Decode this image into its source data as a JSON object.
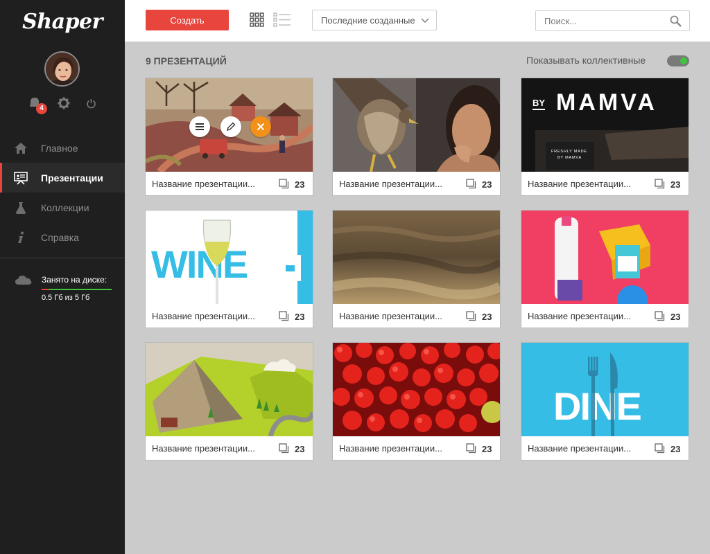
{
  "app": {
    "logo": "Shaper"
  },
  "user": {
    "notifications": "4"
  },
  "sidebar": {
    "items": [
      {
        "label": "Главное",
        "icon": "home-icon",
        "active": false
      },
      {
        "label": "Презентации",
        "icon": "presentation-icon",
        "active": true
      },
      {
        "label": "Коллекции",
        "icon": "flask-icon",
        "active": false
      },
      {
        "label": "Справка",
        "icon": "info-icon",
        "active": false
      }
    ],
    "disk": {
      "label": "Занято на диске:",
      "value": "0.5 Гб из 5 Гб",
      "used_fraction": 0.1,
      "icon": "cloud-icon"
    }
  },
  "toolbar": {
    "create_label": "Создать",
    "sort_value": "Последние созданные",
    "search_placeholder": "Поиск..."
  },
  "content": {
    "count_label": "9 ПРЕЗЕНТАЦИЙ",
    "shared_label": "Показывать коллективные",
    "shared_on": true,
    "cards": [
      {
        "title": "Название презентации...",
        "slides": "23"
      },
      {
        "title": "Название презентации...",
        "slides": "23"
      },
      {
        "title": "Название презентации...",
        "slides": "23",
        "brand_prefix": "BY",
        "brand": "MAMVA",
        "brand_sub1": "FRESHLY MADE",
        "brand_sub2": "BY MAMVA"
      },
      {
        "title": "Название презентации...",
        "slides": "23",
        "word": "WINE"
      },
      {
        "title": "Название презентации...",
        "slides": "23"
      },
      {
        "title": "Название презентации...",
        "slides": "23"
      },
      {
        "title": "Название презентации...",
        "slides": "23"
      },
      {
        "title": "Название презентации...",
        "slides": "23"
      },
      {
        "title": "Название презентации...",
        "slides": "23",
        "word": "DINE"
      }
    ]
  },
  "colors": {
    "accent": "#e8453c",
    "orange": "#f39019",
    "green": "#3ec73e",
    "sidebar": "#1f1f1f"
  }
}
